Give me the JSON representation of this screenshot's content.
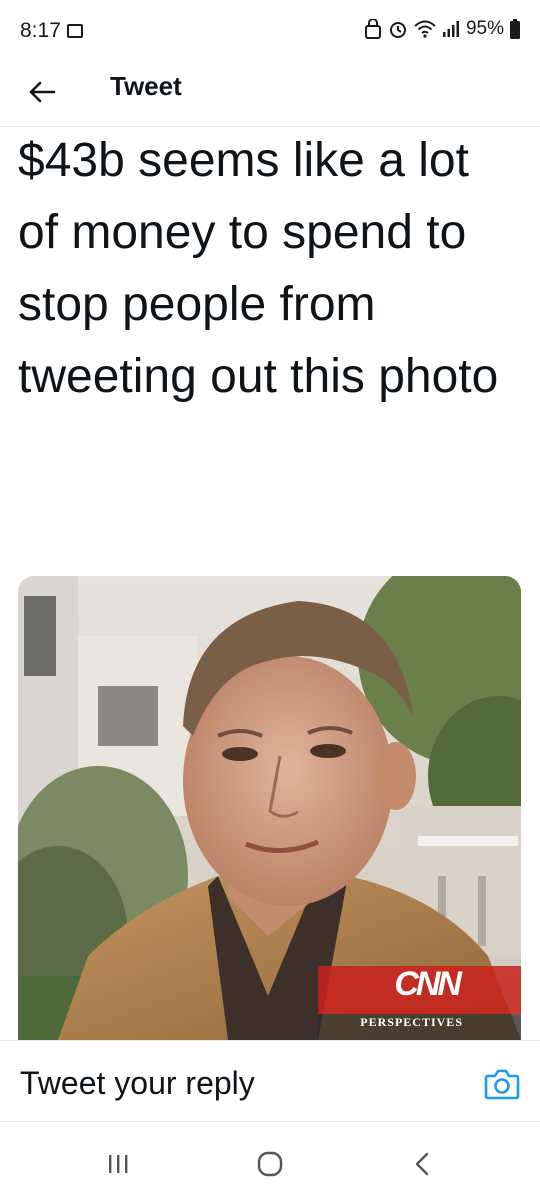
{
  "status_bar": {
    "time": "8:17",
    "battery": "95%"
  },
  "header": {
    "title": "Tweet"
  },
  "tweet": {
    "text": "$43b seems like a lot of money to spend to stop people from tweeting out this photo"
  },
  "media": {
    "logo": "CNN",
    "caption": "PERSPECTIVES"
  },
  "reply": {
    "placeholder": "Tweet your reply"
  },
  "colors": {
    "accent": "#1d9bf0",
    "text": "#0f1419",
    "divider": "#e6e9ec"
  },
  "icons": [
    "gallery-icon",
    "alarm-icon",
    "wifi-icon",
    "signal-icon",
    "battery-icon",
    "back-arrow-icon",
    "camera-icon",
    "recent-apps-icon",
    "home-icon",
    "back-icon"
  ]
}
